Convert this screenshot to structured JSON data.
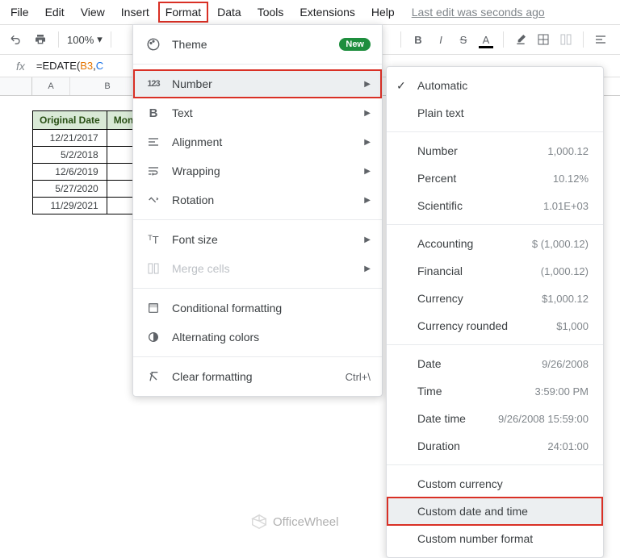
{
  "menubar": {
    "items": [
      "File",
      "Edit",
      "View",
      "Insert",
      "Format",
      "Data",
      "Tools",
      "Extensions",
      "Help"
    ],
    "active_index": 4,
    "lastedit": "Last edit was seconds ago"
  },
  "toolbar": {
    "zoom": "100%"
  },
  "formula": {
    "fn": "=EDATE",
    "p": "(",
    "a1": "B3",
    "c": ",",
    "a2": "C"
  },
  "columns": [
    "A",
    "B"
  ],
  "table": {
    "headers": [
      "Original Date",
      "Mon"
    ],
    "rows": [
      "12/21/2017",
      "5/2/2018",
      "12/6/2019",
      "5/27/2020",
      "11/29/2021"
    ]
  },
  "format_menu": {
    "theme": "Theme",
    "new_badge": "New",
    "number": "Number",
    "text": "Text",
    "alignment": "Alignment",
    "wrapping": "Wrapping",
    "rotation": "Rotation",
    "fontsize": "Font size",
    "merge": "Merge cells",
    "conditional": "Conditional formatting",
    "alternating": "Alternating colors",
    "clear": "Clear formatting",
    "clear_shortcut": "Ctrl+\\"
  },
  "number_menu": {
    "automatic": "Automatic",
    "plaintext": "Plain text",
    "number": {
      "label": "Number",
      "example": "1,000.12"
    },
    "percent": {
      "label": "Percent",
      "example": "10.12%"
    },
    "scientific": {
      "label": "Scientific",
      "example": "1.01E+03"
    },
    "accounting": {
      "label": "Accounting",
      "example": "$ (1,000.12)"
    },
    "financial": {
      "label": "Financial",
      "example": "(1,000.12)"
    },
    "currency": {
      "label": "Currency",
      "example": "$1,000.12"
    },
    "currency_rounded": {
      "label": "Currency rounded",
      "example": "$1,000"
    },
    "date": {
      "label": "Date",
      "example": "9/26/2008"
    },
    "time": {
      "label": "Time",
      "example": "3:59:00 PM"
    },
    "datetime": {
      "label": "Date time",
      "example": "9/26/2008 15:59:00"
    },
    "duration": {
      "label": "Duration",
      "example": "24:01:00"
    },
    "custom_currency": "Custom currency",
    "custom_datetime": "Custom date and time",
    "custom_number": "Custom number format"
  },
  "watermark": "OfficeWheel"
}
